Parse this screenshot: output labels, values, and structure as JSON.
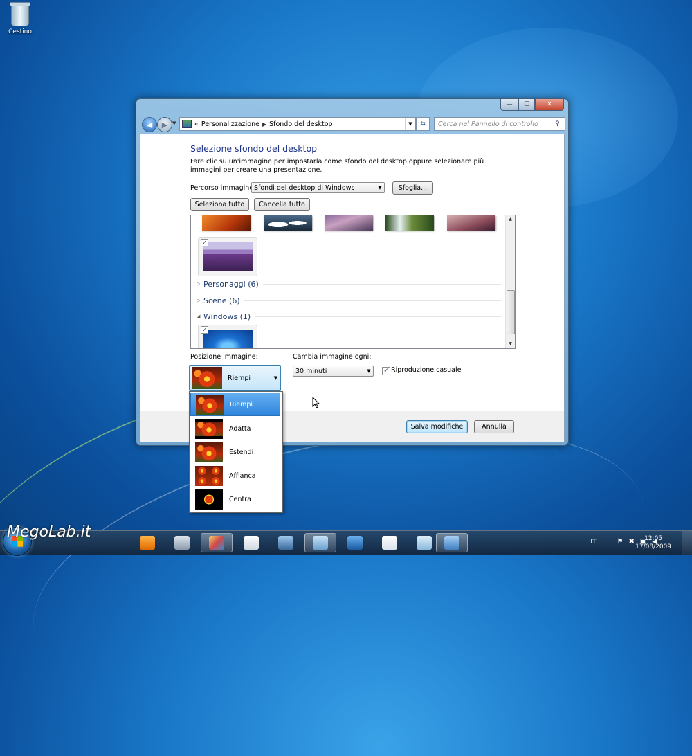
{
  "desktop": {
    "recycle_bin_label": "Cestino"
  },
  "window": {
    "caption": {
      "minimize": "—",
      "maximize": "☐",
      "close": "✕"
    },
    "nav": {
      "address_prefix": "«",
      "breadcrumb": [
        "Personalizzazione",
        "Sfondo del desktop"
      ],
      "search_placeholder": "Cerca nel Pannello di controllo"
    },
    "title": "Selezione sfondo del desktop",
    "description": "Fare clic su un'immagine per impostarla come sfondo del desktop oppure selezionare più immagini per creare una presentazione.",
    "path_label": "Percorso immagine:",
    "path_value": "Sfondi del desktop di Windows",
    "browse_button": "Sfoglia...",
    "select_all": "Seleziona tutto",
    "clear_all": "Cancella tutto",
    "groups": [
      {
        "name": "Personaggi (6)",
        "expanded": false
      },
      {
        "name": "Scene (6)",
        "expanded": false
      },
      {
        "name": "Windows (1)",
        "expanded": true
      }
    ],
    "position_label": "Posizione immagine:",
    "position_value": "Riempi",
    "change_label": "Cambia immagine ogni:",
    "change_value": "30 minuti",
    "shuffle_label": "Riproduzione casuale",
    "shuffle_checked": true,
    "save_button": "Salva modifiche",
    "cancel_button": "Annulla"
  },
  "position_options": [
    {
      "label": "Riempi",
      "selected": true
    },
    {
      "label": "Adatta",
      "selected": false
    },
    {
      "label": "Estendi",
      "selected": false
    },
    {
      "label": "Affianca",
      "selected": false
    },
    {
      "label": "Centra",
      "selected": false
    }
  ],
  "taskbar": {
    "watermark": "MegoLab.it",
    "language": "IT",
    "time": "12:05",
    "date": "17/08/2009"
  }
}
